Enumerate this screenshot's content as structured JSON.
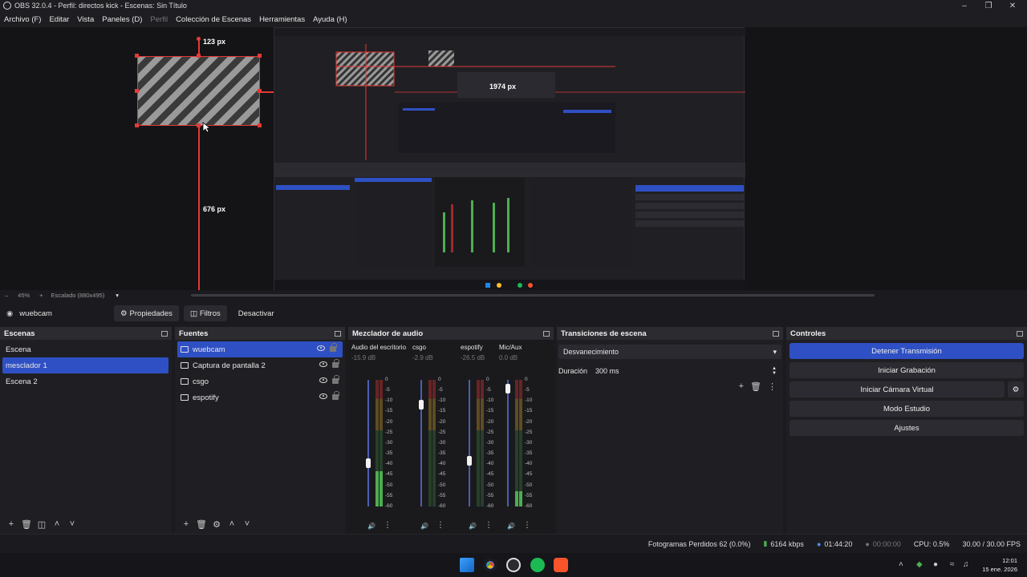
{
  "window": {
    "title": "OBS 32.0.4 - Perfil: directos kick - Escenas: Sin Título"
  },
  "menubar": {
    "items": [
      "Archivo (F)",
      "Editar",
      "Vista",
      "Paneles (D)",
      "Perfil",
      "Colección de Escenas",
      "Herramientas",
      "Ayuda (H)"
    ]
  },
  "preview": {
    "top_label": "123 px",
    "bottom_label": "676 px",
    "right_label": "1974 px"
  },
  "zoombar": {
    "zoom": "45%",
    "scale": "Escalado (880x495)"
  },
  "source_toolbar": {
    "source_name": "wuebcam",
    "properties": "Propiedades",
    "filters": "Filtros",
    "deactivate": "Desactivar"
  },
  "scenes": {
    "title": "Escenas",
    "items": [
      "Escena",
      "mesclador 1",
      "Escena 2"
    ],
    "selected_index": 1
  },
  "sources": {
    "title": "Fuentes",
    "items": [
      {
        "name": "wuebcam",
        "icon": "camera-icon"
      },
      {
        "name": "Captura de pantalla 2",
        "icon": "monitor-icon"
      },
      {
        "name": "csgo",
        "icon": "game-capture-icon"
      },
      {
        "name": "espotify",
        "icon": "window-capture-icon"
      }
    ],
    "selected_index": 0
  },
  "mixer": {
    "title": "Mezclador de audio",
    "ticks": [
      "0",
      "-5",
      "-10",
      "-15",
      "-20",
      "-25",
      "-30",
      "-35",
      "-40",
      "-45",
      "-50",
      "-55",
      "-60"
    ],
    "channels": [
      {
        "name": "Audio del escritorio",
        "db": "-15.9 dB",
        "fader": 0.62,
        "level": 0.28
      },
      {
        "name": "csgo",
        "db": "-2.9 dB",
        "fader": 0.16,
        "level": 0.0
      },
      {
        "name": "espotify",
        "db": "-26.5 dB",
        "fader": 0.6,
        "level": 0.0
      },
      {
        "name": "Mic/Aux",
        "db": "0.0 dB",
        "fader": 0.03,
        "level": 0.12
      }
    ]
  },
  "transitions": {
    "title": "Transiciones de escena",
    "selected": "Desvanecimiento",
    "duration_label": "Duración",
    "duration_value": "300 ms"
  },
  "controls": {
    "title": "Controles",
    "stop_stream": "Detener Transmisión",
    "start_recording": "Iniciar Grabación",
    "start_virtualcam": "Iniciar Cámara Virtual",
    "studio_mode": "Modo Estudio",
    "settings": "Ajustes"
  },
  "status": {
    "dropped_frames": "Fotogramas Perdidos 62 (0.0%)",
    "bitrate": "6164 kbps",
    "stream_time": "01:44:20",
    "rec_time": "00:00:00",
    "cpu": "CPU: 0.5%",
    "fps": "30.00 / 30.00 FPS"
  },
  "taskbar": {
    "time": "12:01",
    "date": "15 ene. 2026"
  },
  "colors": {
    "accent": "#2f50c4",
    "guide": "#e53935",
    "meter_green": "#4caf50",
    "meter_yellow": "#b08a2a",
    "meter_red": "#9c2a2a"
  }
}
